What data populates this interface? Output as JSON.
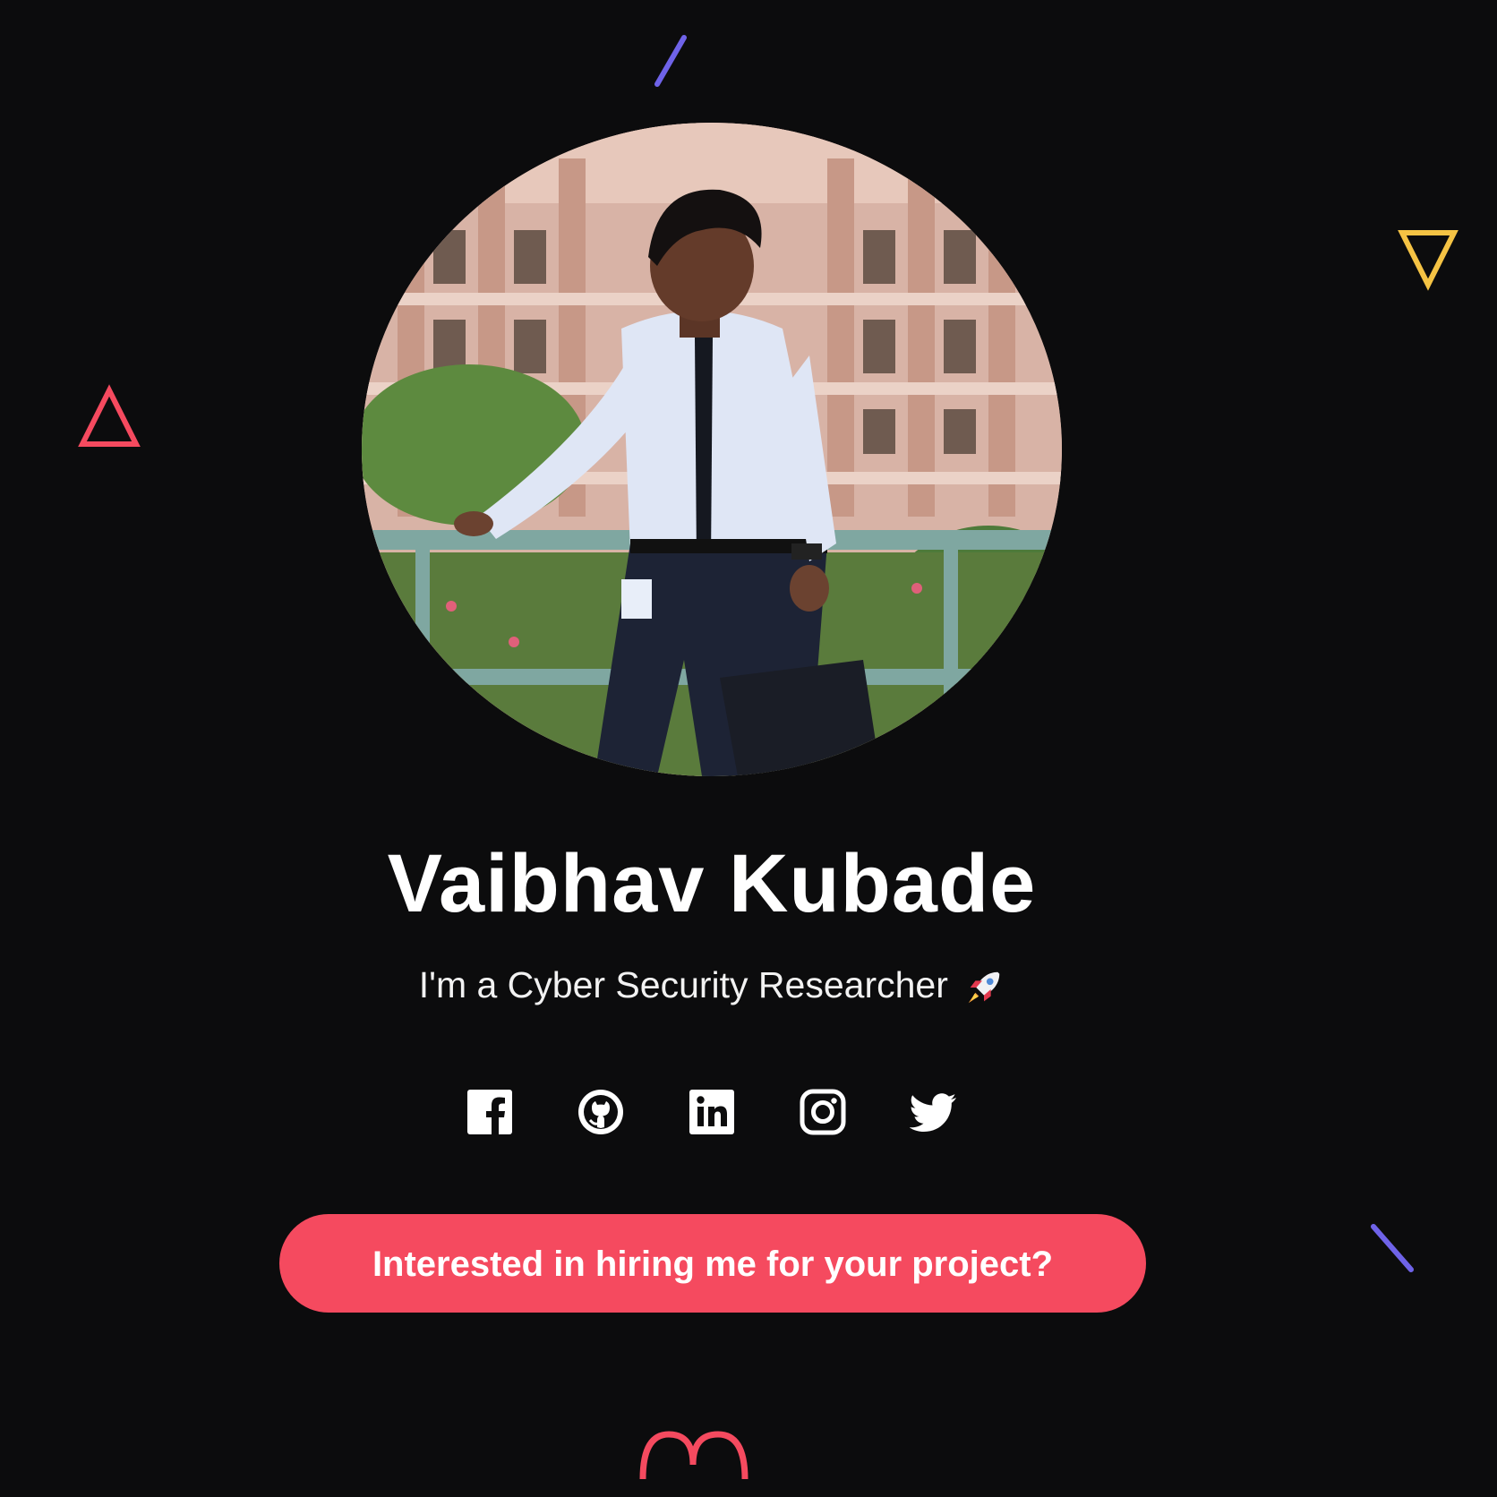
{
  "profile": {
    "name": "Vaibhav Kubade",
    "tagline": "I'm a Cyber Security Researcher"
  },
  "socials": [
    {
      "icon": "facebook-icon"
    },
    {
      "icon": "github-icon"
    },
    {
      "icon": "linkedin-icon"
    },
    {
      "icon": "instagram-icon"
    },
    {
      "icon": "twitter-icon"
    }
  ],
  "cta": {
    "label": "Interested in hiring me for your project?"
  },
  "colors": {
    "background": "#0c0c0d",
    "accent": "#f54a5f",
    "decor_purple": "#6f63e8",
    "decor_yellow": "#f5c344",
    "decor_red": "#f54a5f"
  }
}
